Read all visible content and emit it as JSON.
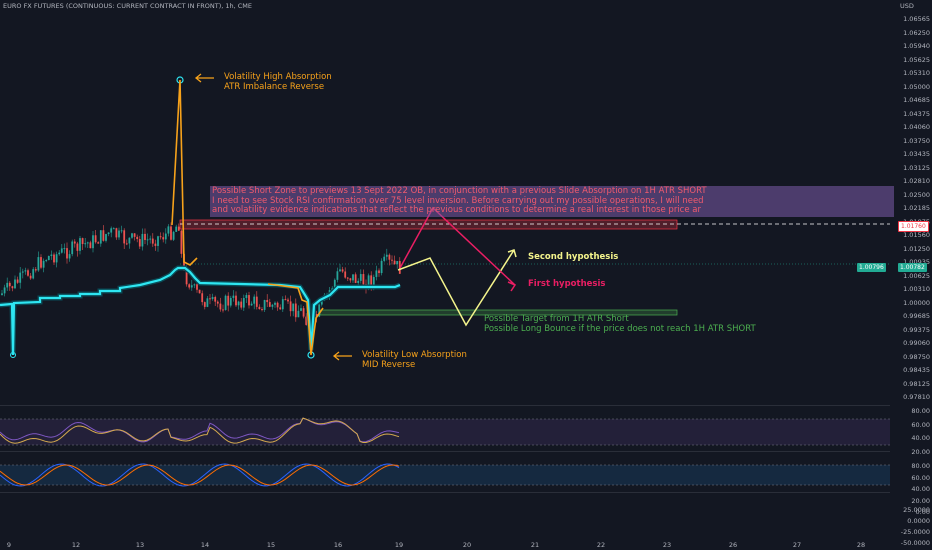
{
  "header": {
    "symbol_line": "EURO FX FUTURES (CONTINUOUS: CURRENT CONTRACT IN FRONT), 1h, CME"
  },
  "price_axis": {
    "currency": "USD",
    "ticks": [
      "1.06565",
      "1.06250",
      "1.05940",
      "1.05625",
      "1.05310",
      "1.05000",
      "1.04685",
      "1.04375",
      "1.04060",
      "1.03750",
      "1.03435",
      "1.03125",
      "1.02810",
      "1.02500",
      "1.02185",
      "1.01875",
      "1.01560",
      "1.01250",
      "1.00935",
      "1.00625",
      "1.00310",
      "1.00000",
      "0.99685",
      "0.99375",
      "0.99060",
      "0.98750",
      "0.98435",
      "0.98125",
      "0.97810"
    ],
    "current_price_tag": "1.00782",
    "ema_tag": "1.00796",
    "level_tag": "1.01760",
    "current_price_color": "#22ab94",
    "level_color": "#f23645"
  },
  "rsi_axis": {
    "ticks": [
      "80.00",
      "60.00",
      "40.00",
      "20.00"
    ]
  },
  "stoch_axis": {
    "ticks": [
      "80.00",
      "60.00",
      "40.00",
      "20.00",
      "0.00"
    ]
  },
  "extra_axis": {
    "ticks": [
      "25.0000",
      "0.0000",
      "-25.0000",
      "-50.0000"
    ]
  },
  "time_axis": {
    "ticks": [
      "9",
      "12",
      "13",
      "14",
      "15",
      "16",
      "19",
      "20",
      "21",
      "22",
      "23",
      "26",
      "27",
      "28"
    ]
  },
  "annotations": {
    "high_absorption": [
      "Volatility High Absorption",
      "ATR Imbalance Reverse"
    ],
    "low_absorption": [
      "Volatility Low Absorption",
      "MID Reverse"
    ],
    "short_zone": [
      "Possible Short Zone to previews 13 Sept 2022 OB, in conjunction with a previous Slide Absorption on 1H ATR SHORT",
      "I need to see Stock RSI confirmation over 75 level inversion. Before carrying out my possible operations, I will need",
      "and volatility evidence indications that reflect the previous conditions to determine a real interest in those price ar"
    ],
    "target": [
      "Possible Target from 1H ATR Short",
      "Possible Long Bounce if the price does not reach 1H ATR SHORT"
    ],
    "second_hypothesis": "Second hypothesis",
    "first_hypothesis": "First hypothesis"
  },
  "colors": {
    "background": "#131722",
    "bull": "#26a69a",
    "bear": "#ef5350",
    "atr_line": "#2ee6f2",
    "orange": "#f7a21b",
    "hyp_yellow": "#f4f48c",
    "hyp_pink": "#e91e63",
    "target_green": "#4caf50",
    "note_red": "#f05a6e"
  }
}
